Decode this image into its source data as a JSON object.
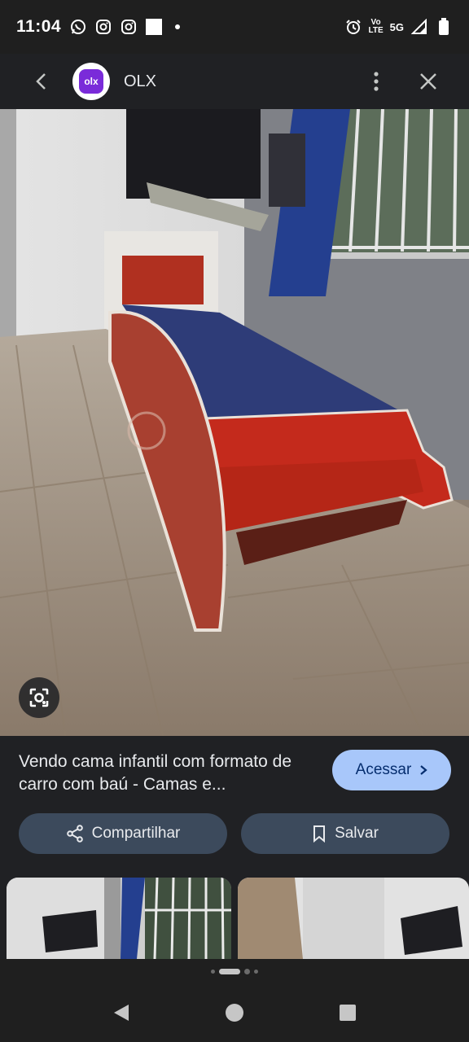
{
  "status_bar": {
    "time": "11:04",
    "left_icons": [
      "whatsapp-icon",
      "instagram-icon",
      "instagram-icon",
      "square-notification-icon",
      "dot-icon"
    ],
    "volte_top": "Vo",
    "volte_bottom": "LTE",
    "network": "5G",
    "right_icons": [
      "alarm-icon",
      "signal-icon",
      "battery-icon"
    ]
  },
  "header": {
    "site_name": "OLX",
    "logo_text": "olx"
  },
  "result": {
    "title": "Vendo cama infantil com formato de carro com baú - Camas e...",
    "visit_label": "Acessar",
    "share_label": "Compartilhar",
    "save_label": "Salvar"
  },
  "pager": {
    "count": 4,
    "active_index": 1
  },
  "colors": {
    "background": "#202124",
    "visit_button": "#a8c7fa",
    "action_button": "#3c4a5c",
    "bed_red": "#c42a1c",
    "mattress_blue": "#2e3c78"
  }
}
